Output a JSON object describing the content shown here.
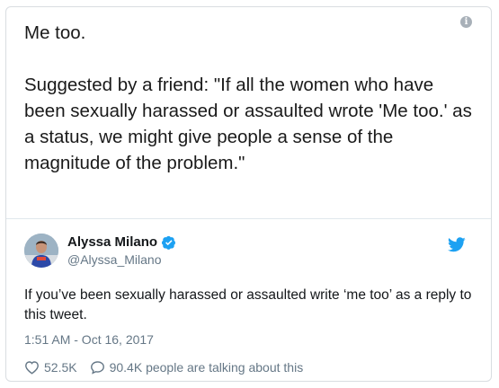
{
  "image_text": {
    "line1": "Me too.",
    "line2": "Suggested by a friend: \"If all the women who have been sexually harassed or assaulted wrote 'Me too.' as a status, we might give people a sense of the magnitude of the problem.\""
  },
  "tweet": {
    "author_name": "Alyssa Milano",
    "handle": "@Alyssa_Milano",
    "text": "If you’ve been sexually harassed or assaulted write ‘me too’ as a reply to this tweet.",
    "timestamp": "1:51 AM - Oct 16, 2017",
    "likes": "52.5K",
    "replies": "90.4K people are talking about this"
  },
  "icons": {
    "info": "info-icon",
    "verified": "verified-badge-icon",
    "brand": "twitter-bird-icon",
    "like": "heart-icon",
    "reply": "speech-bubble-icon"
  },
  "colors": {
    "brand_blue": "#1da1f2",
    "secondary_text": "#657786",
    "primary_text": "#14171a"
  }
}
